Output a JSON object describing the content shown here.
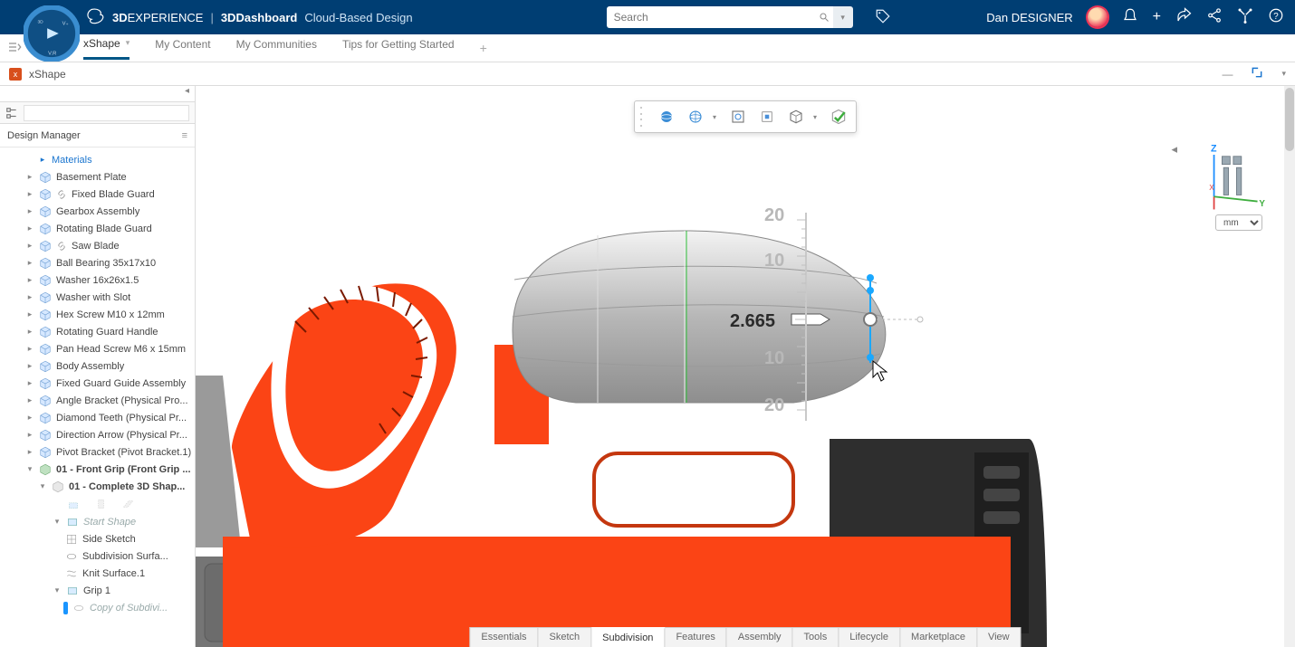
{
  "header": {
    "brand_strong": "3D",
    "brand_rest": "EXPERIENCE",
    "section": "3DDashboard",
    "subtitle": "Cloud-Based Design",
    "search_placeholder": "Search",
    "user_name": "Dan DESIGNER"
  },
  "tabs": {
    "items": [
      "xShape",
      "My Content",
      "My Communities",
      "Tips for Getting Started"
    ],
    "active": 0
  },
  "subbar": {
    "app_name": "xShape"
  },
  "side": {
    "panel_title": "Design Manager",
    "tree": {
      "materials": "Materials",
      "parts": [
        "Basement Plate",
        "Fixed Blade Guard",
        "Gearbox Assembly",
        "Rotating Blade Guard",
        "Saw Blade",
        "Ball Bearing 35x17x10",
        "Washer 16x26x1.5",
        "Washer with Slot",
        "Hex Screw M10 x 12mm",
        "Rotating Guard Handle",
        "Pan Head Screw M6 x 15mm",
        "Body Assembly",
        "Fixed Guard Guide Assembly",
        "Angle Bracket (Physical Pro...",
        "Diamond Teeth (Physical Pr...",
        "Direction Arrow (Physical Pr...",
        "Pivot Bracket (Pivot Bracket.1)"
      ],
      "front_grip": "01 - Front Grip (Front Grip ...",
      "complete_shape": "01 - Complete 3D Shap...",
      "start_shape": "Start Shape",
      "start_children": [
        "Side Sketch",
        "Subdivision Surfa...",
        "Knit Surface.1"
      ],
      "grip1": "Grip 1",
      "grip1_child": "Copy of Subdivi..."
    }
  },
  "viewport": {
    "dimension_value": "2.665",
    "ruler": {
      "t2": "20",
      "t1": "10",
      "b1": "10",
      "b2": "20"
    },
    "unit_options": [
      "mm"
    ],
    "unit_selected": "mm"
  },
  "bottom_tabs": {
    "items": [
      "Essentials",
      "Sketch",
      "Subdivision",
      "Features",
      "Assembly",
      "Tools",
      "Lifecycle",
      "Marketplace",
      "View"
    ],
    "active": 2
  },
  "float_toolbar": {
    "icons": [
      "globe-solid-icon",
      "globe-wire-icon",
      "fit-view-icon",
      "isolate-icon",
      "box-view-icon",
      "commit-icon"
    ]
  }
}
